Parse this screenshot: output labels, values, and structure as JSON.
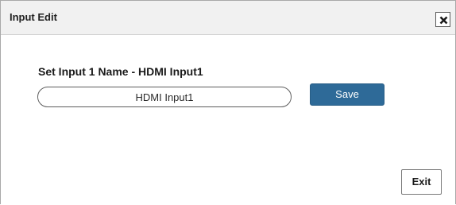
{
  "dialog": {
    "title": "Input Edit",
    "close_icon": "close-x-icon"
  },
  "form": {
    "label": "Set Input 1 Name - HDMI Input1",
    "input_value": "HDMI Input1",
    "save_label": "Save"
  },
  "footer": {
    "exit_label": "Exit"
  },
  "colors": {
    "accent": "#2e6a98",
    "titlebar_bg": "#f1f1f1"
  }
}
